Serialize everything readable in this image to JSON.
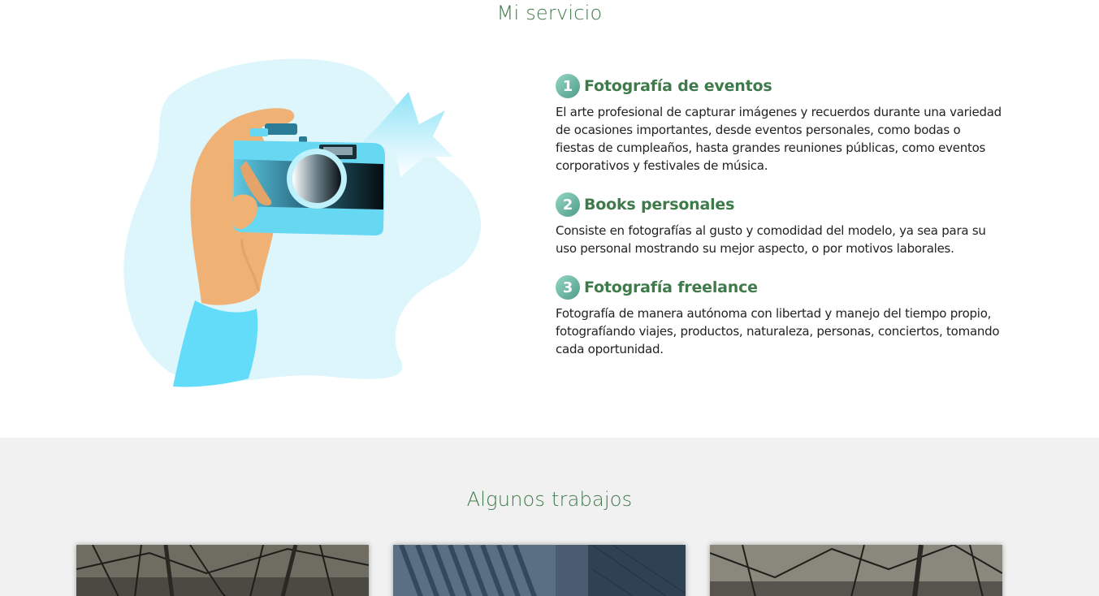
{
  "services_section": {
    "title": "Mi servicio",
    "items": [
      {
        "number": "1",
        "title": "Fotografía de eventos",
        "description": "El arte profesional de capturar imágenes y recuerdos durante una variedad de ocasiones importantes, desde eventos personales, como bodas o fiestas de cumpleaños, hasta grandes reuniones públicas, como eventos corporativos y festivales de música."
      },
      {
        "number": "2",
        "title": "Books personales",
        "description": "Consiste en fotografías al gusto y comodidad del modelo, ya sea para su uso personal mostrando su mejor aspecto, o por motivos laborales."
      },
      {
        "number": "3",
        "title": "Fotografía freelance",
        "description": "Fotografía de manera autónoma con libertad y manejo del tiempo propio, fotografíando viajes, productos, naturaleza, personas, conciertos, tomando cada oportunidad."
      }
    ],
    "illustration_icon": "hand-holding-camera-icon"
  },
  "works_section": {
    "title": "Algunos trabajos",
    "cards": [
      {
        "subject": "bare trees photo"
      },
      {
        "subject": "building facade photo"
      },
      {
        "subject": "bare trees photo"
      }
    ]
  },
  "colors": {
    "accent_green": "#3f7a4a",
    "number_badge": "#6fb5a3",
    "blob": "#dcf6fc",
    "camera_blue": "#67d8f2",
    "works_bg": "#f1f1f1"
  }
}
